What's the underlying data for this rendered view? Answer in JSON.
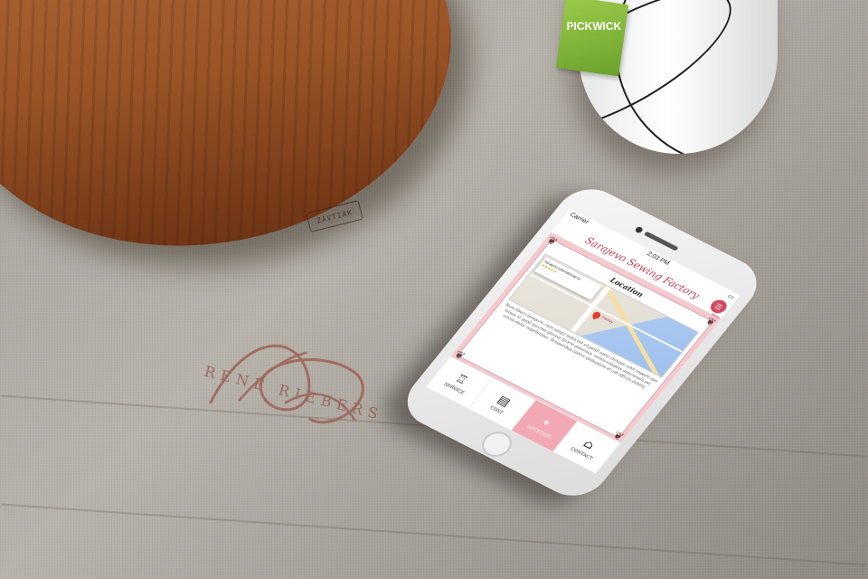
{
  "scene": {
    "board_stamp": "ZAVTIAK",
    "tea_tag_brand": "PICKWICK",
    "embroidered_monogram_text": "RENE RIEBERS"
  },
  "phone": {
    "status_bar": {
      "carrier": "Carrier",
      "time": "2:03 PM",
      "battery_icon": "battery-icon"
    },
    "app_title": "Sarajevo Sewing Factory",
    "menu_label": "Menu",
    "section_title": "Location",
    "map": {
      "business_name": "Sarajevo International Air",
      "rating": "★★★★★",
      "pin_label": "Factory"
    },
    "body_text": "Nam libero tempore, cum soluta nobis est eligendi optio cumque nihil impedit quo minus id quod maxime placeat facere possimus, omnis voluptas assumenda est, omnis dolor repellendus. Temporibus autem quibusdam et aut officiis debitis.",
    "tabs": [
      {
        "label": "Service",
        "icon": "dress-form-icon",
        "active": false
      },
      {
        "label": "Cost",
        "icon": "document-icon",
        "active": false
      },
      {
        "label": "Location",
        "icon": "location-pin-icon",
        "active": true
      },
      {
        "label": "Contact",
        "icon": "house-icon",
        "active": false
      }
    ]
  },
  "colors": {
    "accent": "#c83a50",
    "pink_panel": "#f4c9cf",
    "active_tab": "#f2a9b5"
  }
}
